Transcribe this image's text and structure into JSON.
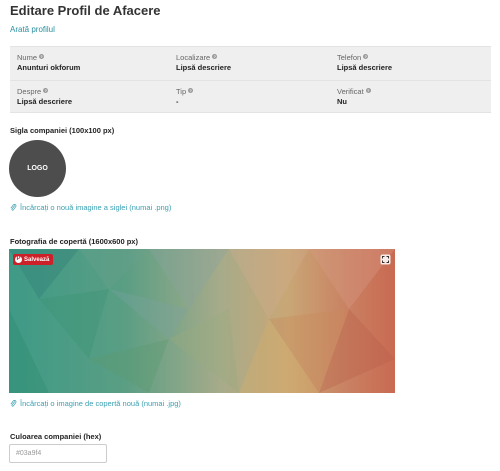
{
  "header": {
    "title": "Editare Profil de Afacere",
    "show_profile_link": "Arată profilul"
  },
  "info": {
    "rows": [
      [
        {
          "label": "Nume",
          "value": "Anunturi okforum"
        },
        {
          "label": "Localizare",
          "value": "Lipsă descriere"
        },
        {
          "label": "Telefon",
          "value": "Lipsă descriere"
        }
      ],
      [
        {
          "label": "Despre",
          "value": "Lipsă descriere"
        },
        {
          "label": "Tip",
          "value": "-"
        },
        {
          "label": "Verificat",
          "value": "Nu"
        }
      ]
    ]
  },
  "logo_section": {
    "label": "Sigla companiei (100x100 px)",
    "logo_text": "LOGO",
    "upload_text": "Încărcați o nouă imagine a siglei (numai .png)"
  },
  "cover_section": {
    "label": "Fotografia de copertă (1600x600 px)",
    "save_button": "Salvează",
    "upload_text": "Încărcați o imagine de copertă nouă (numai .jpg)"
  },
  "color_section": {
    "label": "Culoarea companiei (hex)",
    "placeholder": "#03a9f4"
  },
  "icons": {
    "help": "question-circle-icon",
    "upload": "paperclip-icon",
    "save": "pinterest-icon",
    "expand": "expand-icon"
  },
  "colors": {
    "link": "#3aa0b2",
    "save_button": "#cc2129",
    "logo_bg": "#4d4d4d"
  }
}
